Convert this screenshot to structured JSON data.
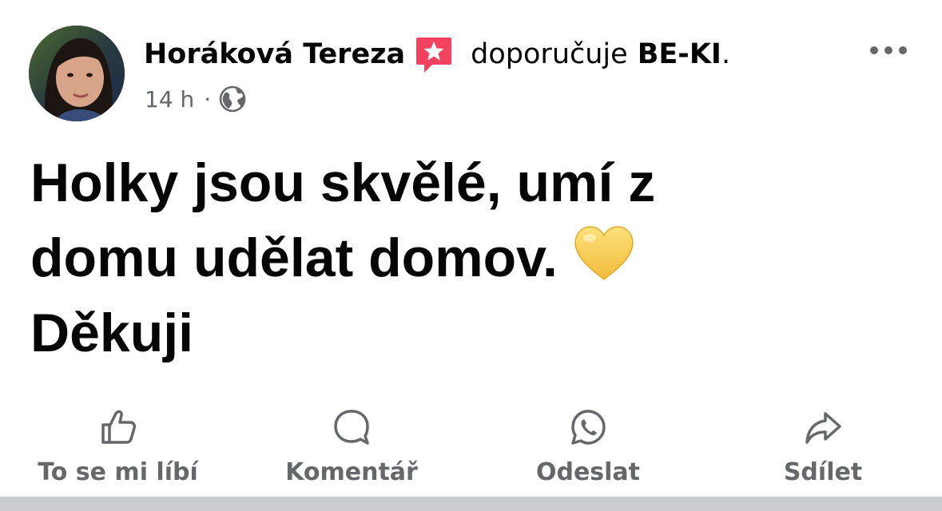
{
  "post": {
    "author": "Horáková Tereza",
    "recommends_text": "doporučuje",
    "page_name": "BE-KI",
    "page_suffix": ".",
    "time": "14 h",
    "separator": "·",
    "privacy_icon": "globe-icon",
    "badge_icon": "recommendation-star-icon",
    "more_icon": "more-horizontal-icon",
    "body": {
      "line1": "Holky jsou skvělé, umí z",
      "line2": "domu udělat domov.",
      "line3": "Děkuji",
      "emoji": "yellow-heart-icon"
    }
  },
  "actions": [
    {
      "label": "To se mi líbí",
      "icon": "like-icon"
    },
    {
      "label": "Komentář",
      "icon": "comment-icon"
    },
    {
      "label": "Odeslat",
      "icon": "whatsapp-icon"
    },
    {
      "label": "Sdílet",
      "icon": "share-icon"
    }
  ],
  "colors": {
    "text": "#050505",
    "secondary_text": "#65676b",
    "badge": "#f3425f",
    "heart": "#f7cb4d",
    "divider": "#c9ccd1"
  }
}
